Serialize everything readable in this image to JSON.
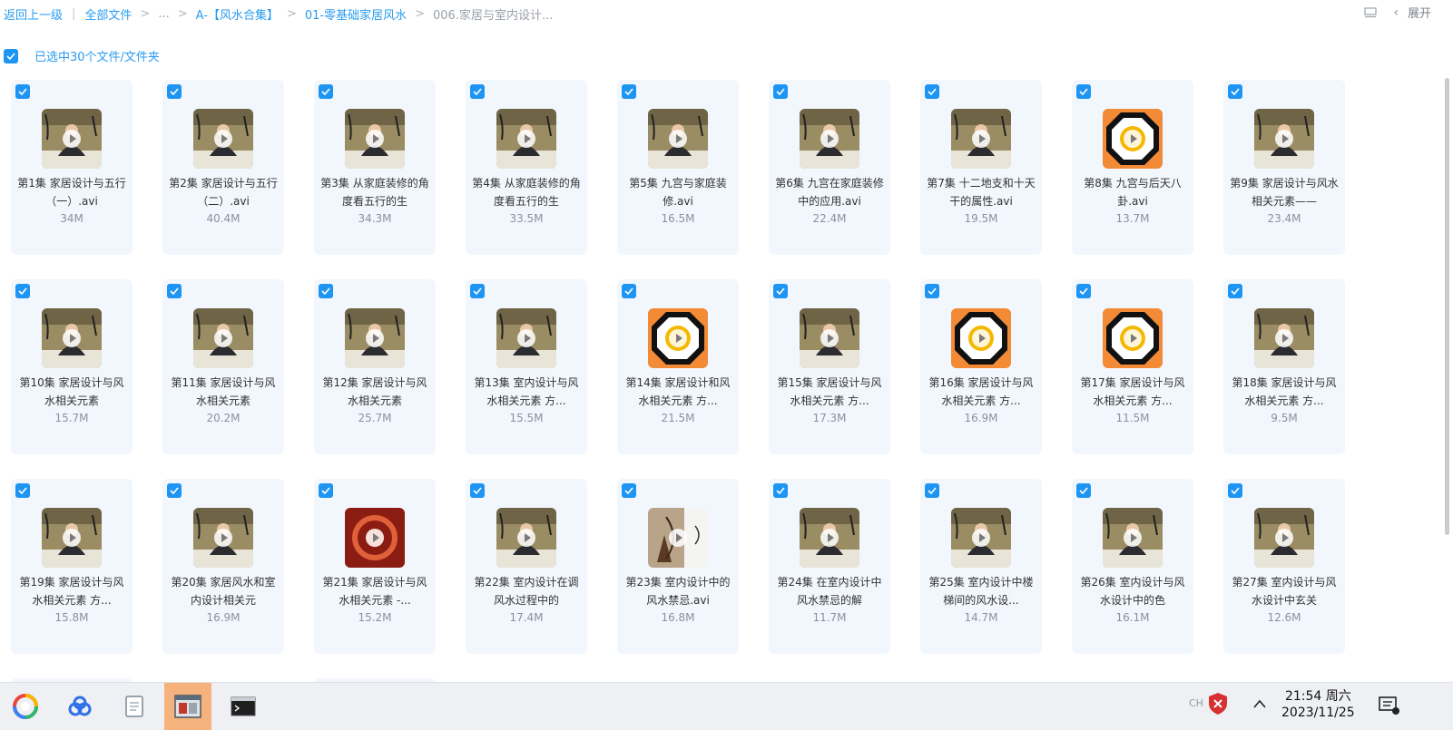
{
  "breadcrumb": {
    "back": "返回上一级",
    "all_files": "全部文件",
    "ellipsis": "...",
    "crumb1": "A-【风水合集】",
    "crumb2": "01-零基础家居风水",
    "current": "006.家居与室内设计..."
  },
  "toolbar": {
    "expand_label": "展开"
  },
  "selection": {
    "label": "已选中30个文件/文件夹"
  },
  "colors": {
    "accent": "#1e95f3",
    "card_bg": "#f1f7fd",
    "taskbar_active": "#f5b27d"
  },
  "files": [
    {
      "name": "第1集 家居设计与五行（一）.avi",
      "size": "34M",
      "thumb": "video"
    },
    {
      "name": "第2集 家居设计与五行（二）.avi",
      "size": "40.4M",
      "thumb": "video"
    },
    {
      "name": "第3集 从家庭装修的角度看五行的生",
      "size": "34.3M",
      "thumb": "video"
    },
    {
      "name": "第4集 从家庭装修的角度看五行的生",
      "size": "33.5M",
      "thumb": "video"
    },
    {
      "name": "第5集 九宫与家庭装修.avi",
      "size": "16.5M",
      "thumb": "video"
    },
    {
      "name": "第6集 九宫在家庭装修中的应用.avi",
      "size": "22.4M",
      "thumb": "video"
    },
    {
      "name": "第7集 十二地支和十天干的属性.avi",
      "size": "19.5M",
      "thumb": "video"
    },
    {
      "name": "第8集 九宫与后天八卦.avi",
      "size": "13.7M",
      "thumb": "bagua"
    },
    {
      "name": "第9集 家居设计与风水相关元素——",
      "size": "23.4M",
      "thumb": "video"
    },
    {
      "name": "第10集 家居设计与风水相关元素",
      "size": "15.7M",
      "thumb": "video"
    },
    {
      "name": "第11集 家居设计与风水相关元素",
      "size": "20.2M",
      "thumb": "video"
    },
    {
      "name": "第12集 家居设计与风水相关元素",
      "size": "25.7M",
      "thumb": "video"
    },
    {
      "name": "第13集 室内设计与风水相关元素 方...",
      "size": "15.5M",
      "thumb": "video"
    },
    {
      "name": "第14集 家居设计和风水相关元素 方...",
      "size": "21.5M",
      "thumb": "bagua"
    },
    {
      "name": "第15集 家居设计与风水相关元素 方...",
      "size": "17.3M",
      "thumb": "video"
    },
    {
      "name": "第16集 家居设计与风水相关元素 方...",
      "size": "16.9M",
      "thumb": "bagua"
    },
    {
      "name": "第17集 家居设计与风水相关元素 方...",
      "size": "11.5M",
      "thumb": "bagua"
    },
    {
      "name": "第18集 家居设计与风水相关元素 方...",
      "size": "9.5M",
      "thumb": "video"
    },
    {
      "name": "第19集 家居设计与风水相关元素 方...",
      "size": "15.8M",
      "thumb": "video"
    },
    {
      "name": "第20集 家居风水和室内设计相关元",
      "size": "16.9M",
      "thumb": "video"
    },
    {
      "name": "第21集 家居设计与风水相关元素 -...",
      "size": "15.2M",
      "thumb": "red"
    },
    {
      "name": "第22集 室内设计在调风水过程中的",
      "size": "17.4M",
      "thumb": "video"
    },
    {
      "name": "第23集 室内设计中的风水禁忌.avi",
      "size": "16.8M",
      "thumb": "archer"
    },
    {
      "name": "第24集 在室内设计中风水禁忌的解",
      "size": "11.7M",
      "thumb": "video"
    },
    {
      "name": "第25集 室内设计中楼梯间的风水设...",
      "size": "14.7M",
      "thumb": "video"
    },
    {
      "name": "第26集 室内设计与风水设计中的色",
      "size": "16.1M",
      "thumb": "video"
    },
    {
      "name": "第27集 室内设计与风水设计中玄关",
      "size": "12.6M",
      "thumb": "video"
    }
  ],
  "taskbar": {
    "apps": [
      "color-wheel-app",
      "cloud-app",
      "notepad-app",
      "window-app",
      "terminal-app"
    ],
    "time": "21:54 周六",
    "date": "2023/11/25",
    "ime": "CH"
  }
}
